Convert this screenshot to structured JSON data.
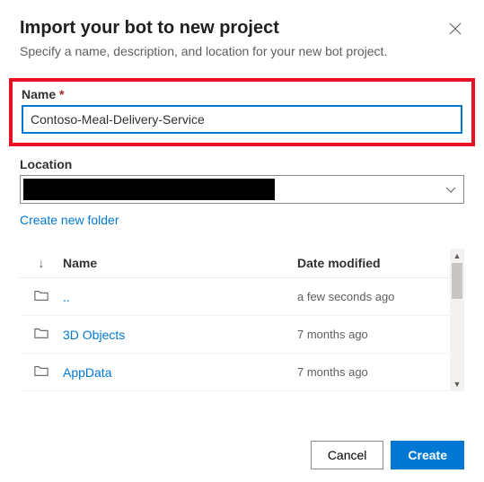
{
  "header": {
    "title": "Import your bot to new project",
    "subtitle": "Specify a name, description, and location for your new bot project."
  },
  "nameField": {
    "label": "Name",
    "required": "*",
    "value": "Contoso-Meal-Delivery-Service"
  },
  "locationField": {
    "label": "Location"
  },
  "createFolderLink": "Create new folder",
  "listHeaders": {
    "sortIcon": "↓",
    "name": "Name",
    "date": "Date modified"
  },
  "rows": [
    {
      "name": "..",
      "date": "a few seconds ago"
    },
    {
      "name": "3D Objects",
      "date": "7 months ago"
    },
    {
      "name": "AppData",
      "date": "7 months ago"
    }
  ],
  "footer": {
    "cancel": "Cancel",
    "create": "Create"
  }
}
